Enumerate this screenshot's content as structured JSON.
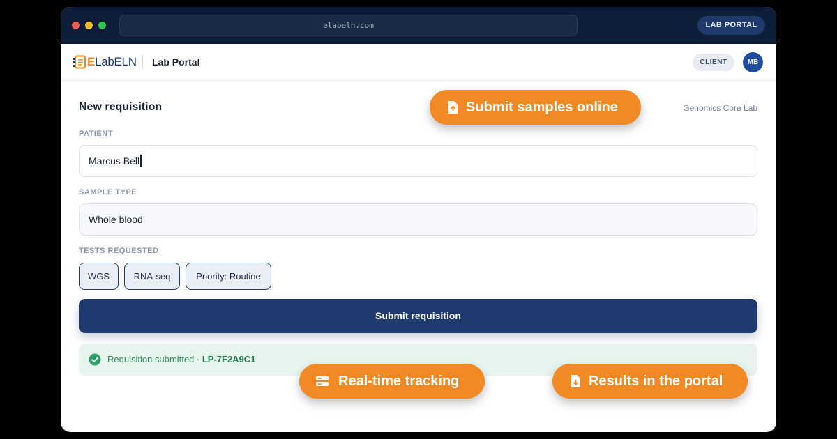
{
  "browser": {
    "url": "elabeln.com",
    "badge": "LAB PORTAL"
  },
  "header": {
    "logo_e": "E",
    "logo_rest": "LabELN",
    "app_title": "Lab Portal",
    "role_badge": "CLIENT",
    "avatar_initials": "MB"
  },
  "form": {
    "title": "New requisition",
    "lab_name": "Genomics Core Lab",
    "patient_label": "PATIENT",
    "patient_value": "Marcus Bell",
    "sample_type_label": "SAMPLE TYPE",
    "sample_type_value": "Whole blood",
    "tests_label": "TESTS REQUESTED",
    "tests": [
      "WGS",
      "RNA-seq",
      "Priority: Routine"
    ],
    "submit_label": "Submit requisition"
  },
  "status": {
    "message": "Requisition submitted · ",
    "code": "LP-7F2A9C1"
  },
  "callouts": {
    "submit": "Submit samples online",
    "tracking": "Real-time tracking",
    "results": "Results in the portal"
  },
  "colors": {
    "brand_navy": "#1e3a6f",
    "accent_orange": "#f18a24",
    "success_green": "#2e8a5a"
  }
}
